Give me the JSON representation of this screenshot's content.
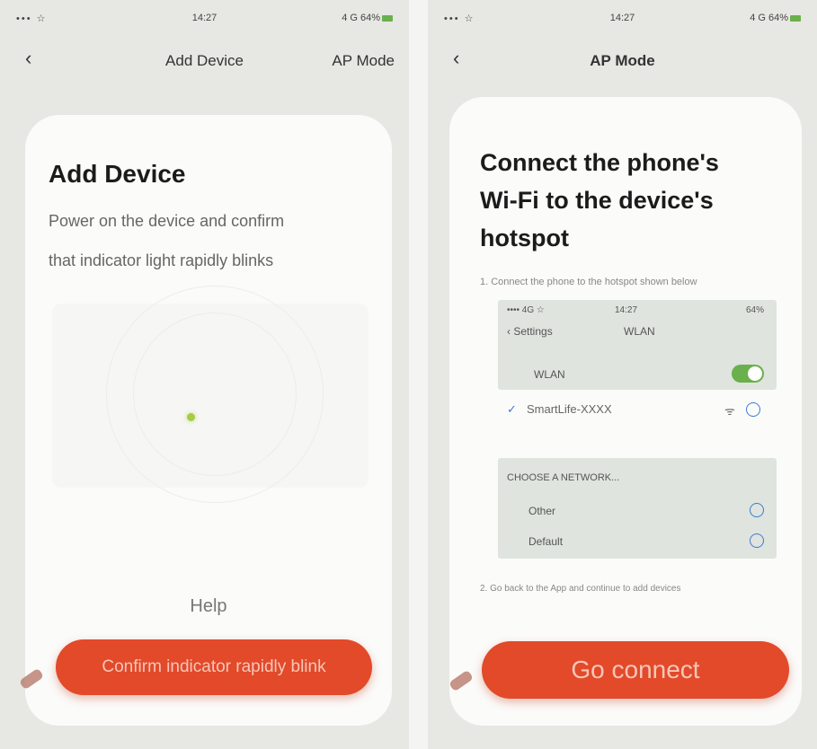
{
  "left": {
    "status": {
      "signal": "••• ☆",
      "time": "14:27",
      "battery": "4 G 64%"
    },
    "nav": {
      "back_icon": "‹",
      "title": "Add Device",
      "right_link": "AP Mode"
    },
    "card": {
      "heading": "Add Device",
      "line1": "Power on the device and confirm",
      "line2": "that indicator light rapidly blinks",
      "help": "Help",
      "confirm_button": "Confirm indicator rapidly blink"
    }
  },
  "right": {
    "status": {
      "signal": "••• ☆",
      "time": "14:27",
      "battery": "4 G 64%"
    },
    "nav": {
      "back_icon": "‹",
      "title": "AP Mode"
    },
    "card": {
      "heading_line1": "Connect the phone's",
      "heading_line2": "Wi-Fi to the device's",
      "heading_line3": "hotspot",
      "step1": "1. Connect the phone to the hotspot shown below",
      "wifi_status_left": "•••• 4G ☆",
      "wifi_status_mid": "14:27",
      "wifi_status_right": "64%",
      "wifi_back": "‹ Settings",
      "wifi_title": "WLAN",
      "wifi_label": "WLAN",
      "connected_network": "SmartLife-XXXX",
      "choose_network": "CHOOSE A NETWORK...",
      "network1": "Other",
      "network2": "Default",
      "step2": "2. Go back to the App and continue to add devices",
      "go_button": "Go connect"
    }
  },
  "colors": {
    "accent": "#e24a2a",
    "toggle": "#6ab04c",
    "led": "#a4cc45"
  }
}
